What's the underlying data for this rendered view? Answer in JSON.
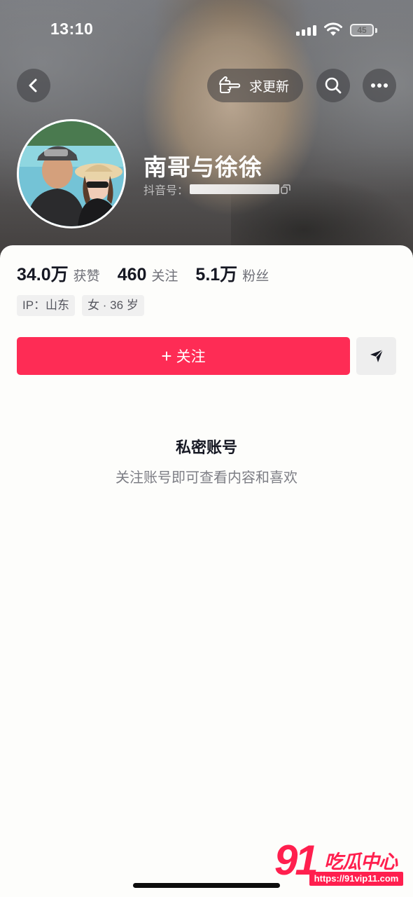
{
  "status_bar": {
    "time": "13:10",
    "battery": "45"
  },
  "header": {
    "update_label": "求更新",
    "nickname": "南哥与徐徐",
    "id_label": "抖音号："
  },
  "stats": [
    {
      "value": "34.0万",
      "label": "获赞"
    },
    {
      "value": "460",
      "label": "关注"
    },
    {
      "value": "5.1万",
      "label": "粉丝"
    }
  ],
  "tags": [
    "IP：山东",
    "女 · 36 岁"
  ],
  "actions": {
    "follow_plus": "+",
    "follow_label": "关注"
  },
  "private": {
    "title": "私密账号",
    "subtitle": "关注账号即可查看内容和喜欢"
  },
  "watermark": {
    "logo": "91",
    "text": "吃瓜中心",
    "url": "https://91vip11.com"
  },
  "colors": {
    "accent": "#fe2c55",
    "text_primary": "#161823",
    "text_secondary": "#6e6f77"
  },
  "icons": {
    "back": "chevron-left-icon",
    "update": "pointing-hand-icon",
    "search": "search-icon",
    "more": "more-dots-icon",
    "share": "paper-plane-icon",
    "copy": "copy-icon"
  }
}
